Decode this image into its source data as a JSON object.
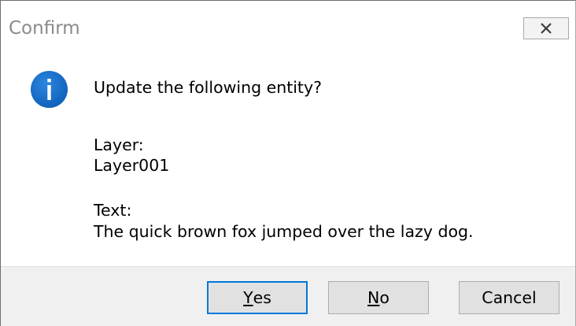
{
  "window": {
    "title": "Confirm"
  },
  "message": {
    "prompt": "Update the following entity?",
    "layer_label": "Layer:",
    "layer_value": "Layer001",
    "text_label": "Text:",
    "text_value": "The quick brown fox jumped over the lazy dog."
  },
  "buttons": {
    "yes": {
      "mnemonic": "Y",
      "rest": "es"
    },
    "no": {
      "mnemonic": "N",
      "rest": "o"
    },
    "cancel": "Cancel"
  },
  "icons": {
    "dialog_icon": "info-icon",
    "close": "close-icon"
  },
  "colors": {
    "info_blue": "#1a6fc7",
    "default_button_border": "#0078d7",
    "footer_bg": "#f0f0f0"
  }
}
